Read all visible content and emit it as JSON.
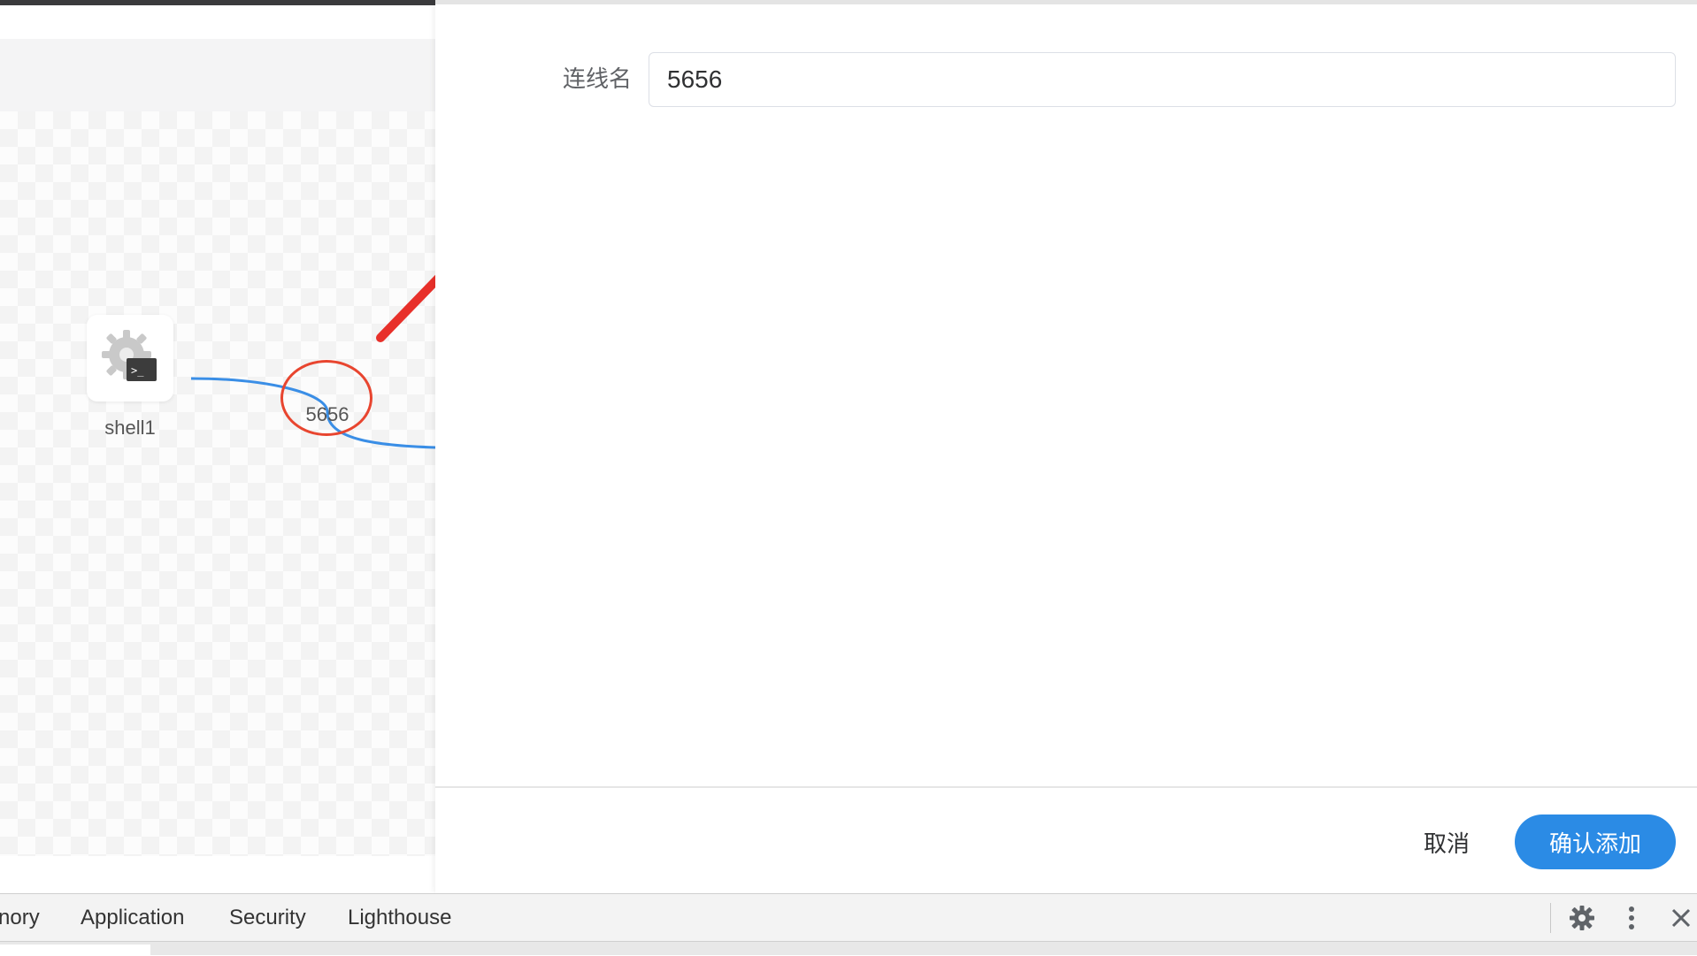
{
  "canvas": {
    "node": {
      "label": "shell1",
      "icon": "shell-gear-icon"
    },
    "edge": {
      "label": "5656",
      "color": "#3a8ee6"
    }
  },
  "annotation": {
    "color": "#e8452f"
  },
  "drawer": {
    "field_label": "连线名",
    "field_value": "5656",
    "cancel_label": "取消",
    "confirm_label": "确认添加",
    "accent": "#2b8be5"
  },
  "devtools": {
    "tabs": [
      "nory",
      "Application",
      "Security",
      "Lighthouse"
    ],
    "icons": [
      "gear-icon",
      "more-vert-icon",
      "close-icon"
    ]
  }
}
